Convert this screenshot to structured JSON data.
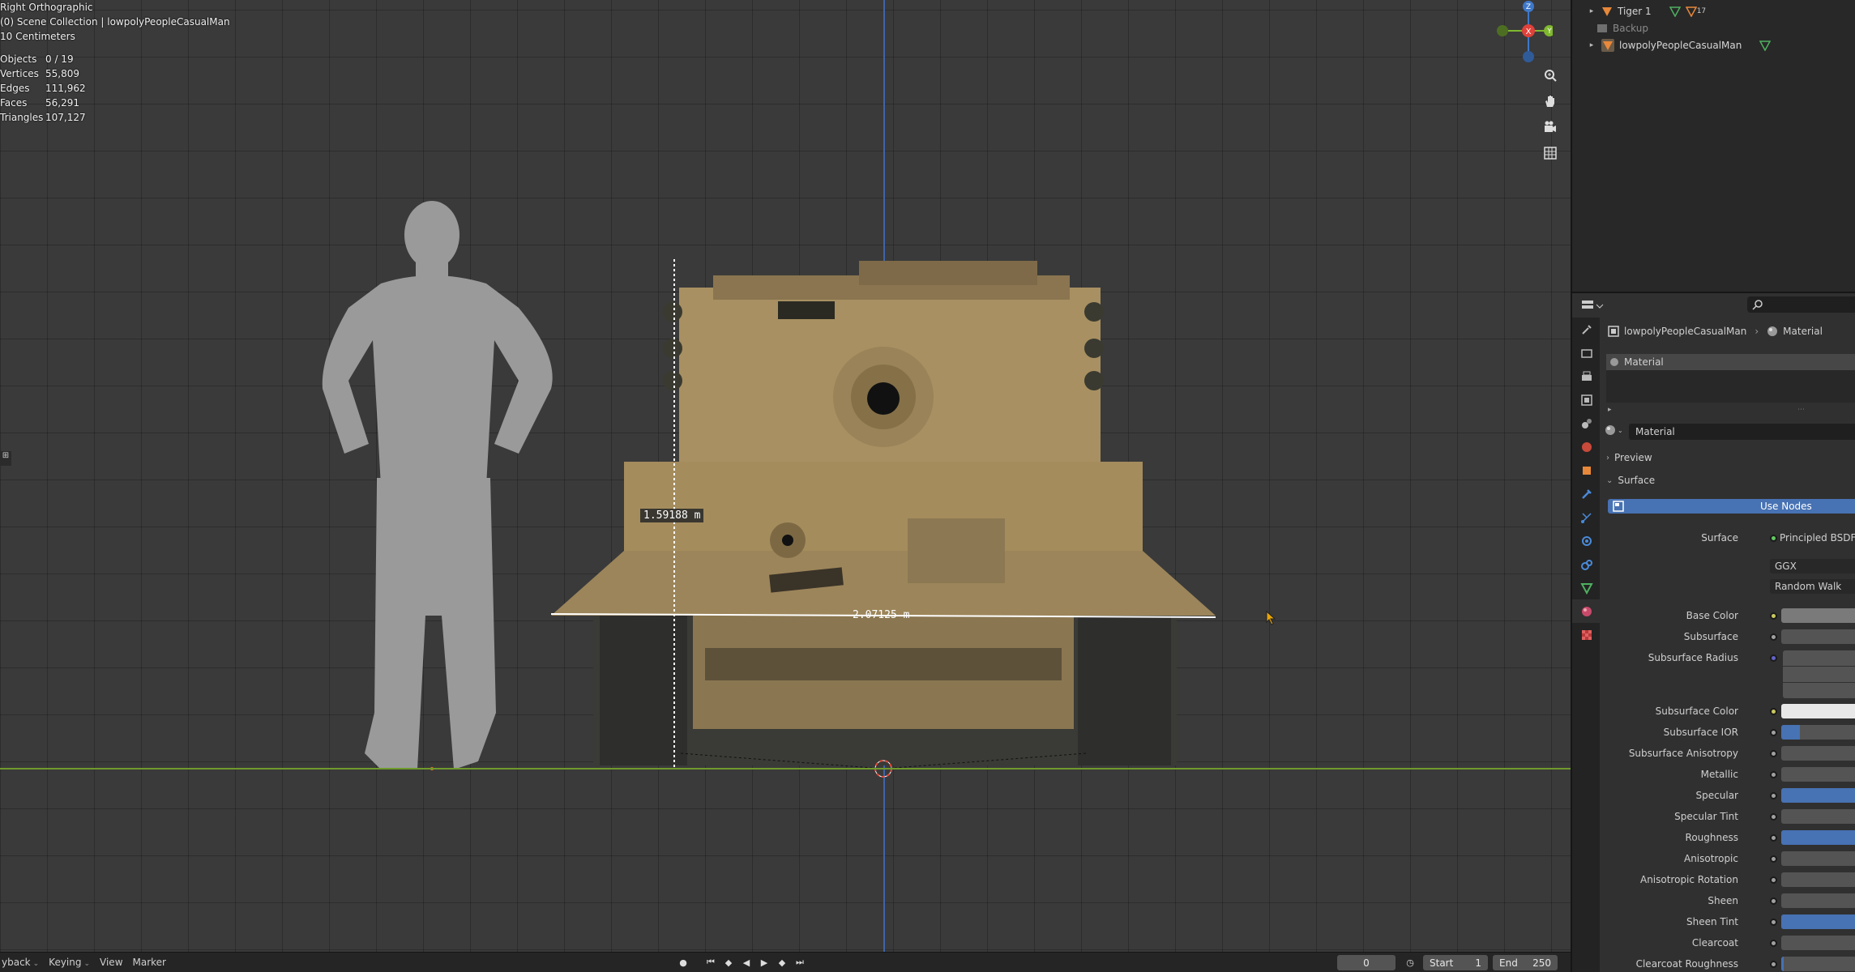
{
  "viewport": {
    "view_name": "Right Orthographic",
    "collection": "(0) Scene Collection | lowpolyPeopleCasualMan",
    "scale": "10 Centimeters",
    "stats": [
      {
        "label": "Objects",
        "value": "0 / 19"
      },
      {
        "label": "Vertices",
        "value": "55,809"
      },
      {
        "label": "Edges",
        "value": "111,962"
      },
      {
        "label": "Faces",
        "value": "56,291"
      },
      {
        "label": "Triangles",
        "value": "107,127"
      }
    ],
    "measure_vertical": "1.59188 m",
    "measure_horizontal": "2.07125 m",
    "gizmo_axes": {
      "z": "Z",
      "x": "X",
      "y": "Y"
    },
    "colors": {
      "x_axis": "#e0413a",
      "y_axis": "#7fb82d",
      "z_axis": "#3e78c9",
      "tank": "#a88e5c",
      "person": "#9a9a9a"
    }
  },
  "timeline": {
    "menus": [
      "yback",
      "Keying",
      "View",
      "Marker"
    ],
    "current_frame": "0",
    "start_label": "Start",
    "start_value": "1",
    "end_label": "End",
    "end_value": "250"
  },
  "outliner": {
    "items": [
      {
        "name": "Tiger 1",
        "badge": "17"
      },
      {
        "name": "Backup"
      },
      {
        "name": "lowpolyPeopleCasualMan"
      }
    ]
  },
  "properties": {
    "breadcrumb_object": "lowpolyPeopleCasualMan",
    "breadcrumb_material": "Material",
    "slot_name": "Material",
    "material_name": "Material",
    "section_preview": "Preview",
    "section_surface": "Surface",
    "use_nodes": "Use Nodes",
    "surface_label": "Surface",
    "surface_value": "Principled BSDF",
    "distribution": "GGX",
    "subsurface_method": "Random Walk",
    "inputs": [
      {
        "label": "Base Color",
        "dot": "yellow",
        "swatch": "#7a7a7a"
      },
      {
        "label": "Subsurface",
        "dot": "gray",
        "fill": 0
      },
      {
        "label": "Subsurface Radius",
        "dot": "purple",
        "vector": true
      },
      {
        "label": "Subsurface Color",
        "dot": "yellow",
        "swatch": "#e8e8e8"
      },
      {
        "label": "Subsurface IOR",
        "dot": "gray",
        "fill": 0.25
      },
      {
        "label": "Subsurface Anisotropy",
        "dot": "gray",
        "fill": 0
      },
      {
        "label": "Metallic",
        "dot": "gray",
        "fill": 0
      },
      {
        "label": "Specular",
        "dot": "gray",
        "fill": 1
      },
      {
        "label": "Specular Tint",
        "dot": "gray",
        "fill": 0
      },
      {
        "label": "Roughness",
        "dot": "gray",
        "fill": 1
      },
      {
        "label": "Anisotropic",
        "dot": "gray",
        "fill": 0
      },
      {
        "label": "Anisotropic Rotation",
        "dot": "gray",
        "fill": 0
      },
      {
        "label": "Sheen",
        "dot": "gray",
        "fill": 0
      },
      {
        "label": "Sheen Tint",
        "dot": "gray",
        "fill": 1
      },
      {
        "label": "Clearcoat",
        "dot": "gray",
        "fill": 0
      },
      {
        "label": "Clearcoat Roughness",
        "dot": "gray",
        "fill": 0.03
      }
    ]
  }
}
